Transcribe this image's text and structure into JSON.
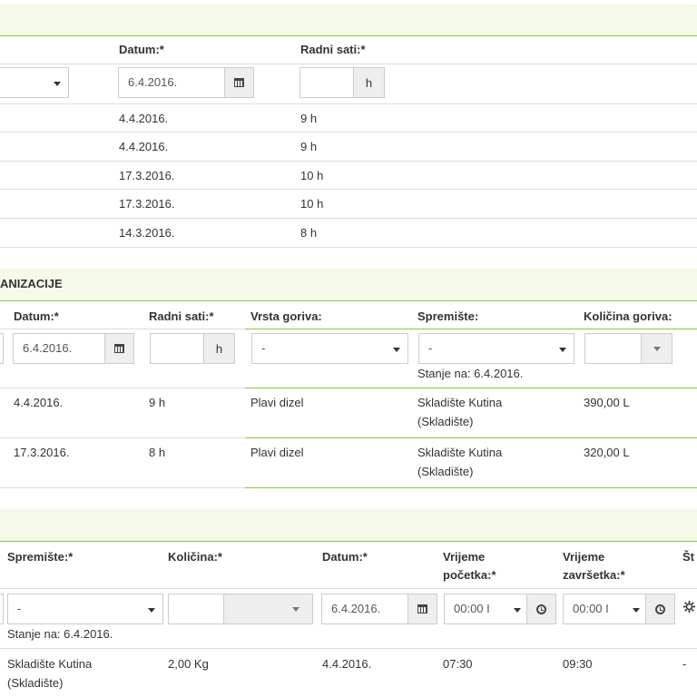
{
  "section1": {
    "headers": {
      "datum": "Datum:*",
      "radni_sati": "Radni sati:*"
    },
    "input": {
      "date_value": "6.4.2016.",
      "hours_addon": "h"
    },
    "rows": [
      {
        "datum": "4.4.2016.",
        "sati": "9 h"
      },
      {
        "datum": "4.4.2016.",
        "sati": "9 h"
      },
      {
        "datum": "17.3.2016.",
        "sati": "10 h"
      },
      {
        "datum": "17.3.2016.",
        "sati": "10 h"
      },
      {
        "datum": "14.3.2016.",
        "sati": "8 h"
      }
    ]
  },
  "section2": {
    "title": "ANIZACIJE",
    "headers": {
      "datum": "Datum:*",
      "radni_sati": "Radni sati:*",
      "vrsta_goriva": "Vrsta goriva:",
      "spremiste": "Spremište:",
      "kolicina_goriva": "Količina goriva:"
    },
    "input": {
      "date_value": "6.4.2016.",
      "hours_addon": "h",
      "vrsta_selected": "-",
      "spremiste_selected": "-",
      "stanje": "Stanje na: 6.4.2016."
    },
    "rows": [
      {
        "datum": "4.4.2016.",
        "sati": "9 h",
        "gorivo": "Plavi dizel",
        "spremiste_l1": "Skladište Kutina",
        "spremiste_l2": "(Skladište)",
        "kolicina": "390,00 L"
      },
      {
        "datum": "17.3.2016.",
        "sati": "8 h",
        "gorivo": "Plavi dizel",
        "spremiste_l1": "Skladište Kutina",
        "spremiste_l2": "(Skladište)",
        "kolicina": "320,00 L"
      }
    ]
  },
  "section3": {
    "headers": {
      "spremiste": "Spremište:*",
      "kolicina": "Količina:*",
      "datum": "Datum:*",
      "vrijeme_pocetka_l1": "Vrijeme",
      "vrijeme_pocetka_l2": "početka:*",
      "vrijeme_zavrsetka_l1": "Vrijeme",
      "vrijeme_zavrsetka_l2": "završetka:*",
      "cut": "Št"
    },
    "input": {
      "spremiste_selected": "-",
      "stanje": "Stanje na: 6.4.2016.",
      "date_value": "6.4.2016.",
      "start_time": "00:00 I",
      "end_time": "00:00 I"
    },
    "rows": [
      {
        "spremiste_l1": "Skladište Kutina",
        "spremiste_l2": "(Skladište)",
        "kolicina": "2,00 Kg",
        "datum": "4.4.2016.",
        "pocetak": "07:30",
        "zavrsetak": "09:30",
        "cut": "-"
      }
    ]
  },
  "colors": {
    "accent": "#8cc63f",
    "band": "#f4f9ea"
  },
  "icons": {
    "calendar": "calendar-icon",
    "clock": "clock-icon",
    "gear": "gear-icon"
  }
}
